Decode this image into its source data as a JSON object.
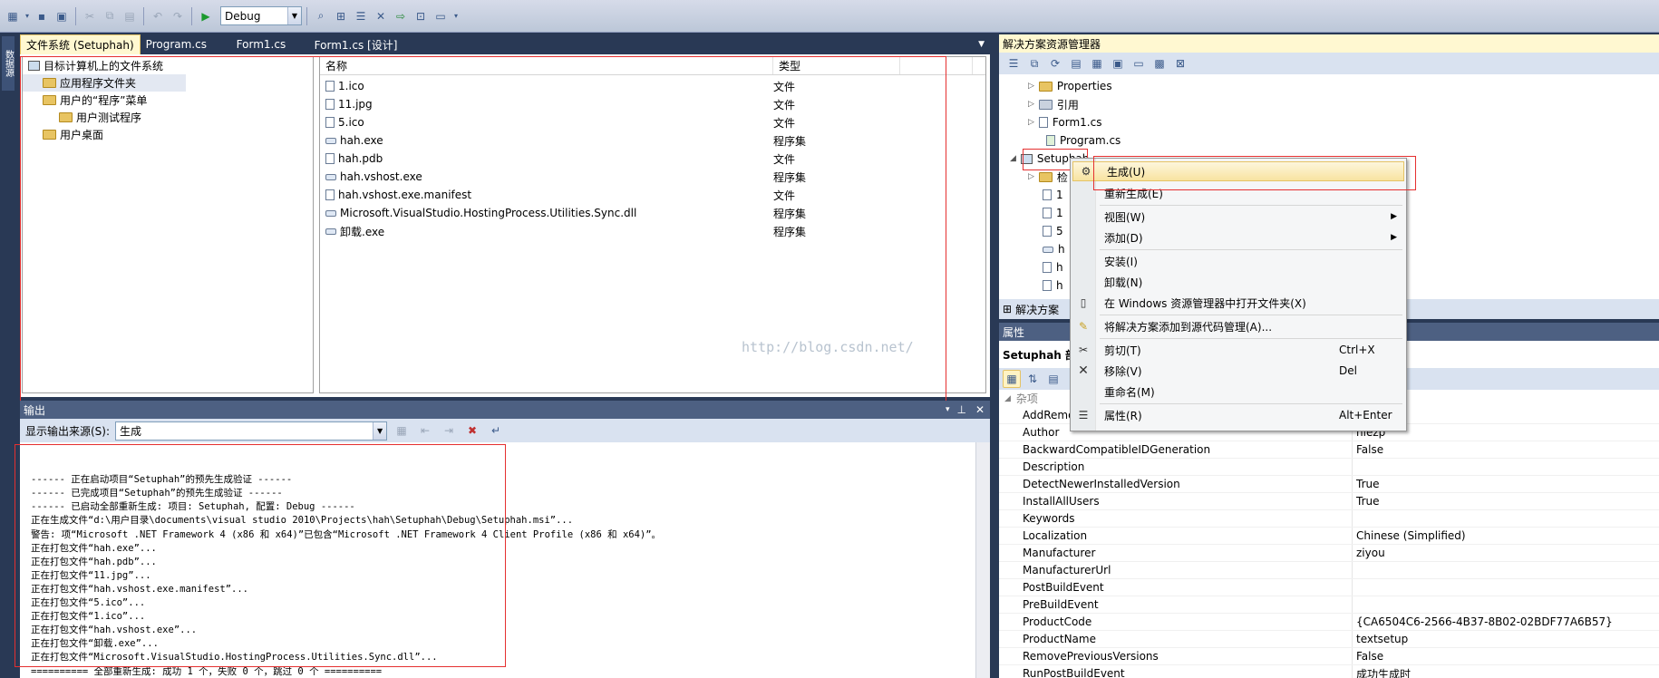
{
  "toolbar": {
    "config_value": "Debug"
  },
  "left_strip": {
    "tab_label": "数据源"
  },
  "tabs": [
    {
      "label": "文件系统 (Setuphah)",
      "active": true
    },
    {
      "label": "Program.cs"
    },
    {
      "label": "Form1.cs"
    },
    {
      "label": "Form1.cs [设计]"
    }
  ],
  "filesystem_tree": {
    "root": "目标计算机上的文件系统",
    "items": [
      "应用程序文件夹",
      "用户的“程序”菜单",
      "用户测试程序",
      "用户桌面"
    ]
  },
  "file_list": {
    "col_name": "名称",
    "col_type": "类型",
    "rows": [
      {
        "name": "1.ico",
        "type": "文件"
      },
      {
        "name": "11.jpg",
        "type": "文件"
      },
      {
        "name": "5.ico",
        "type": "文件"
      },
      {
        "name": "hah.exe",
        "type": "程序集"
      },
      {
        "name": "hah.pdb",
        "type": "文件"
      },
      {
        "name": "hah.vshost.exe",
        "type": "程序集"
      },
      {
        "name": "hah.vshost.exe.manifest",
        "type": "文件"
      },
      {
        "name": "Microsoft.VisualStudio.HostingProcess.Utilities.Sync.dll",
        "type": "程序集"
      },
      {
        "name": "卸载.exe",
        "type": "程序集"
      }
    ]
  },
  "output": {
    "title": "输出",
    "source_label": "显示输出来源(S):",
    "source_value": "生成",
    "lines": [
      "------ 正在启动项目“Setuphah”的预先生成验证 ------",
      "------ 已完成项目“Setuphah”的预先生成验证 ------",
      "------ 已启动全部重新生成: 项目: Setuphah, 配置: Debug ------",
      "正在生成文件“d:\\用户目录\\documents\\visual studio 2010\\Projects\\hah\\Setuphah\\Debug\\Setuphah.msi”...",
      "警告: 项“Microsoft .NET Framework 4 (x86 和 x64)”已包含“Microsoft .NET Framework 4 Client Profile (x86 和 x64)”。",
      "正在打包文件“hah.exe”...",
      "正在打包文件“hah.pdb”...",
      "正在打包文件“11.jpg”...",
      "正在打包文件“hah.vshost.exe.manifest”...",
      "正在打包文件“5.ico”...",
      "正在打包文件“1.ico”...",
      "正在打包文件“hah.vshost.exe”...",
      "正在打包文件“卸载.exe”...",
      "正在打包文件“Microsoft.VisualStudio.HostingProcess.Utilities.Sync.dll”...",
      "========== 全部重新生成: 成功 1 个，失败 0 个，跳过 0 个 =========="
    ]
  },
  "solution_explorer": {
    "title": "解决方案资源管理器",
    "nodes": [
      "Properties",
      "引用",
      "Form1.cs",
      "Program.cs",
      "Setuphah"
    ],
    "child_fragments": [
      "检",
      "1",
      "1",
      "5",
      "h",
      "h",
      "h"
    ],
    "tab_label": "解决方案"
  },
  "properties": {
    "title": "属性",
    "object": "Setuphah 部",
    "category": "杂项",
    "rows": [
      {
        "key": "AddRemo",
        "value": ""
      },
      {
        "key": "Author",
        "value": "niezp"
      },
      {
        "key": "BackwardCompatibleIDGeneration",
        "value": "False"
      },
      {
        "key": "Description",
        "value": ""
      },
      {
        "key": "DetectNewerInstalledVersion",
        "value": "True"
      },
      {
        "key": "InstallAllUsers",
        "value": "True"
      },
      {
        "key": "Keywords",
        "value": ""
      },
      {
        "key": "Localization",
        "value": "Chinese (Simplified)"
      },
      {
        "key": "Manufacturer",
        "value": "ziyou"
      },
      {
        "key": "ManufacturerUrl",
        "value": ""
      },
      {
        "key": "PostBuildEvent",
        "value": ""
      },
      {
        "key": "PreBuildEvent",
        "value": ""
      },
      {
        "key": "ProductCode",
        "value": "{CA6504C6-2566-4B37-8B02-02BDF77A6B57}"
      },
      {
        "key": "ProductName",
        "value": "textsetup"
      },
      {
        "key": "RemovePreviousVersions",
        "value": "False"
      },
      {
        "key": "RunPostBuildEvent",
        "value": "成功生成时"
      }
    ]
  },
  "context_menu": {
    "items": [
      {
        "label": "生成(U)",
        "shortcut": ""
      },
      {
        "label": "重新生成(E)",
        "shortcut": ""
      },
      {
        "label": "视图(W)",
        "shortcut": ""
      },
      {
        "label": "添加(D)",
        "shortcut": ""
      },
      {
        "label": "安装(I)",
        "shortcut": ""
      },
      {
        "label": "卸载(N)",
        "shortcut": ""
      },
      {
        "label": "在 Windows 资源管理器中打开文件夹(X)",
        "shortcut": ""
      },
      {
        "label": "将解决方案添加到源代码管理(A)...",
        "shortcut": ""
      },
      {
        "label": "剪切(T)",
        "shortcut": "Ctrl+X"
      },
      {
        "label": "移除(V)",
        "shortcut": "Del"
      },
      {
        "label": "重命名(M)",
        "shortcut": ""
      },
      {
        "label": "属性(R)",
        "shortcut": "Alt+Enter"
      }
    ]
  },
  "watermark": "http://blog.csdn.net/",
  "icons": [
    "new-project-icon",
    "save-icon",
    "save-all-icon",
    "cut-icon",
    "copy-icon",
    "paste-icon",
    "undo-icon",
    "redo-icon",
    "start-debug-icon",
    "solution-explorer-icon",
    "properties-icon",
    "toolbox-icon",
    "cut-icon",
    "delete-icon",
    "pin-icon",
    "close-icon"
  ]
}
